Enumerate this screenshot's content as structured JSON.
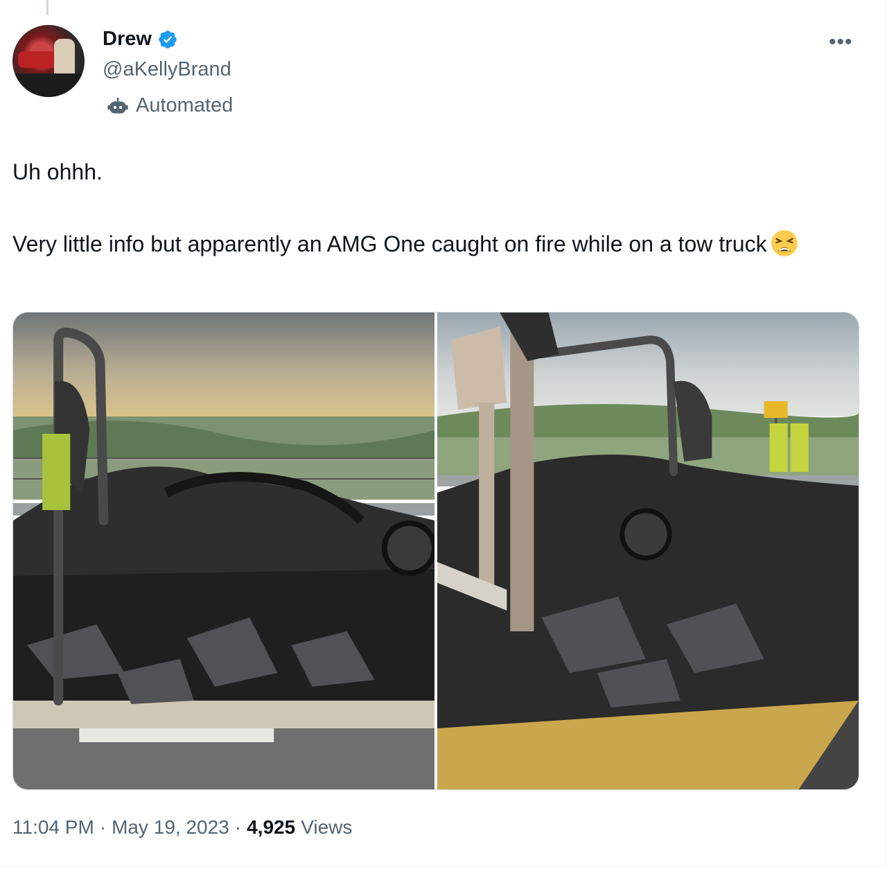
{
  "author": {
    "name": "Drew",
    "handle": "@aKellyBrand",
    "label": "Automated",
    "verified_color": "#1d9bf0"
  },
  "more_icon": "more-horizontal-icon",
  "tweet": {
    "paragraph1": "Uh ohhh.",
    "paragraph2": "Very little info but apparently an AMG One caught on fire while on a tow truck",
    "emoji": "weary-face"
  },
  "media": [
    {
      "alt": "burned car on tow truck, left photo"
    },
    {
      "alt": "burned car on tow truck, right photo"
    }
  ],
  "meta": {
    "time": "11:04 PM",
    "date": "May 19, 2023",
    "separator": "·",
    "views_count": "4,925",
    "views_label": "Views"
  }
}
